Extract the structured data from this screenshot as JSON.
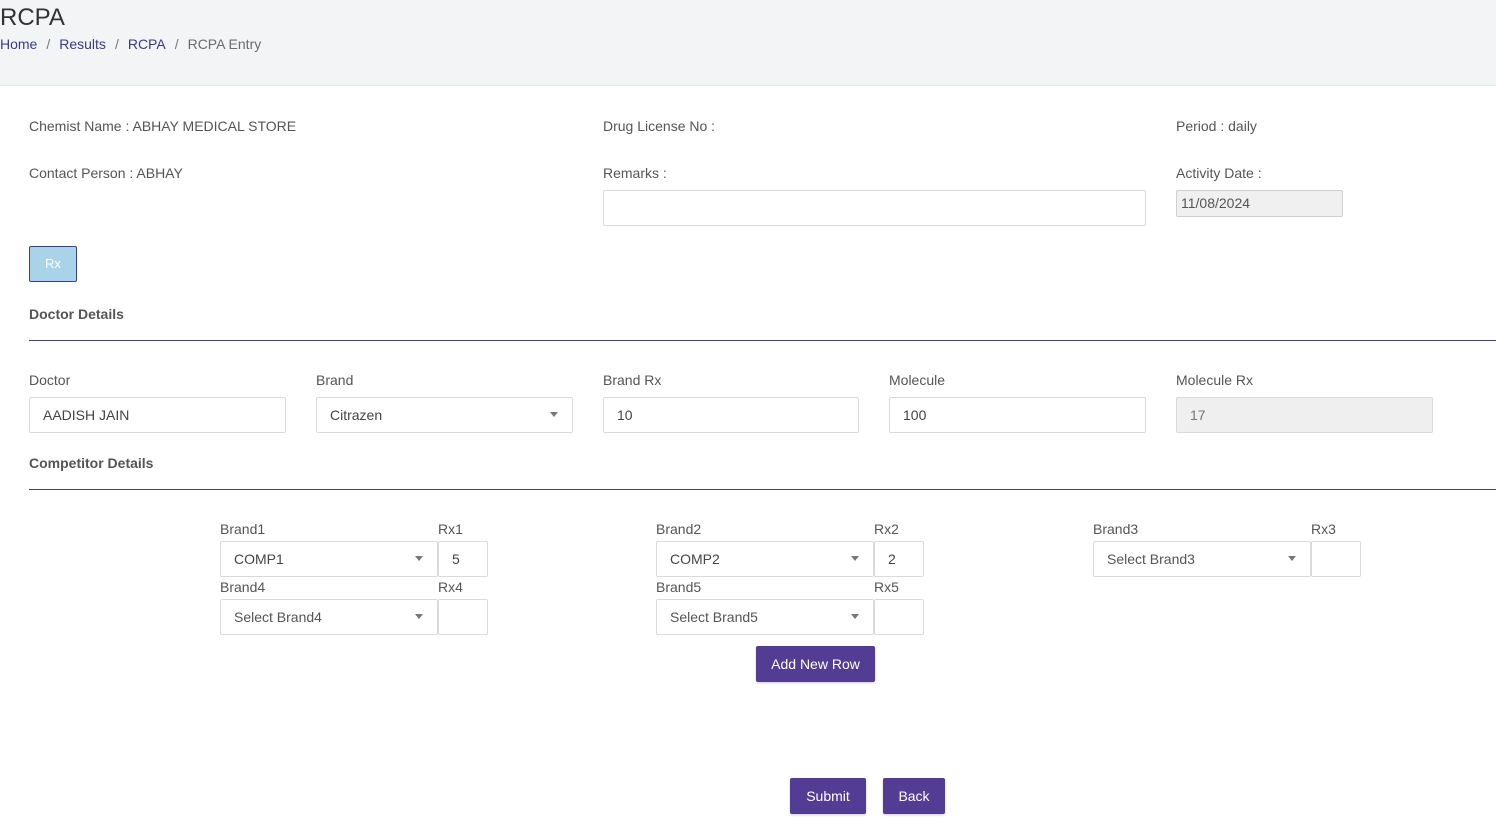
{
  "header": {
    "title": "RCPA",
    "breadcrumb": {
      "home": "Home",
      "results": "Results",
      "rcpa": "RCPA",
      "current": "RCPA Entry",
      "separator": "/"
    }
  },
  "info": {
    "chemist_name": "Chemist Name : ABHAY MEDICAL STORE",
    "drug_license": "Drug License No :",
    "period": "Period : daily",
    "contact_person": "Contact Person : ABHAY",
    "remarks_label": "Remarks :",
    "remarks_value": "",
    "activity_date_label": "Activity Date :",
    "activity_date_value": "11/08/2024"
  },
  "rx_button": "Rx",
  "doctor_section": {
    "title": "Doctor Details",
    "doctor_label": "Doctor",
    "doctor_value": "AADISH JAIN",
    "brand_label": "Brand",
    "brand_value": "Citrazen",
    "brand_rx_label": "Brand Rx",
    "brand_rx_value": "10",
    "molecule_label": "Molecule",
    "molecule_value": "100",
    "molecule_rx_label": "Molecule Rx",
    "molecule_rx_value": "17"
  },
  "competitor_section": {
    "title": "Competitor Details",
    "brand1_label": "Brand1",
    "brand1_value": "COMP1",
    "rx1_label": "Rx1",
    "rx1_value": "5",
    "brand2_label": "Brand2",
    "brand2_value": "COMP2",
    "rx2_label": "Rx2",
    "rx2_value": "2",
    "brand3_label": "Brand3",
    "brand3_value": "Select Brand3",
    "rx3_label": "Rx3",
    "rx3_value": "",
    "brand4_label": "Brand4",
    "brand4_value": "Select Brand4",
    "rx4_label": "Rx4",
    "rx4_value": "",
    "brand5_label": "Brand5",
    "brand5_value": "Select Brand5",
    "rx5_label": "Rx5",
    "rx5_value": ""
  },
  "buttons": {
    "add_row": "Add New Row",
    "submit": "Submit",
    "back": "Back"
  },
  "colors": {
    "primary": "#533c93",
    "rx_button": "#a9d3e8",
    "header_bg": "#f3f4f6",
    "link": "#3a3a8c"
  }
}
